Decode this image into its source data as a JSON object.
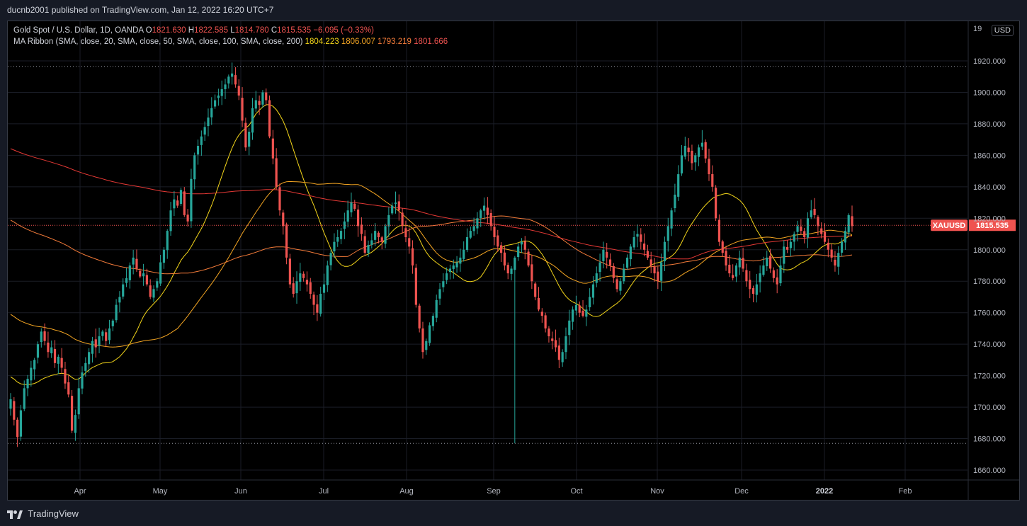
{
  "header": {
    "published_text": "ducnb2001 published on TradingView.com, Jan 12, 2022 16:20 UTC+7"
  },
  "legend": {
    "symbol_title": "Gold Spot / U.S. Dollar, 1D, OANDA",
    "o_label": "O",
    "o_value": "1821.630",
    "h_label": "H",
    "h_value": "1822.585",
    "l_label": "L",
    "l_value": "1814.780",
    "c_label": "C",
    "c_value": "1815.535",
    "change": "−6.095 (−0.33%)",
    "ma_title": "MA Ribbon (SMA, close, 20, SMA, close, 50, SMA, close, 100, SMA, close, 200)",
    "ma_values": [
      "1804.223",
      "1806.007",
      "1793.219",
      "1801.666"
    ]
  },
  "currency_badge": "USD",
  "price_tag": {
    "symbol": "XAUUSD",
    "value": "1815.535"
  },
  "footer": {
    "brand": "TradingView"
  },
  "colors": {
    "up": "#26a69a",
    "down": "#ef5350",
    "ma20": "#f5d71a",
    "ma50": "#f5a623",
    "ma100": "#f57c3a",
    "ma200": "#e53935",
    "background": "#000000",
    "grid": "#1a1d26"
  },
  "chart_data": {
    "type": "candlestick",
    "title": "Gold Spot / U.S. Dollar, 1D, OANDA",
    "ylim": [
      1650,
      1950
    ],
    "y_ticks": [
      "1660.000",
      "1680.000",
      "1700.000",
      "1720.000",
      "1740.000",
      "1760.000",
      "1780.000",
      "1800.000",
      "1820.000",
      "1840.000",
      "1860.000",
      "1880.000",
      "1900.000",
      "1920.000"
    ],
    "y_top_partial": "19",
    "x_ticks": [
      "Apr",
      "May",
      "Jun",
      "Jul",
      "Aug",
      "Sep",
      "Oct",
      "Nov",
      "Dec",
      "2022",
      "Feb"
    ],
    "current_price": 1815.535,
    "dotted_levels": [
      1916.5,
      1677.0
    ],
    "close_series_approx": [
      1705,
      1692,
      1681,
      1698,
      1712,
      1718,
      1725,
      1730,
      1740,
      1748,
      1742,
      1735,
      1738,
      1728,
      1732,
      1725,
      1715,
      1708,
      1685,
      1695,
      1712,
      1722,
      1728,
      1735,
      1742,
      1738,
      1745,
      1748,
      1742,
      1750,
      1755,
      1765,
      1770,
      1778,
      1782,
      1790,
      1795,
      1788,
      1783,
      1785,
      1778,
      1770,
      1775,
      1780,
      1792,
      1800,
      1812,
      1825,
      1832,
      1828,
      1838,
      1822,
      1818,
      1845,
      1860,
      1866,
      1872,
      1878,
      1884,
      1890,
      1895,
      1898,
      1902,
      1905,
      1910,
      1912,
      1905,
      1898,
      1882,
      1865,
      1875,
      1890,
      1895,
      1892,
      1900,
      1895,
      1872,
      1858,
      1840,
      1825,
      1815,
      1795,
      1778,
      1772,
      1780,
      1785,
      1782,
      1778,
      1772,
      1765,
      1760,
      1772,
      1778,
      1790,
      1798,
      1805,
      1808,
      1812,
      1818,
      1825,
      1830,
      1826,
      1815,
      1810,
      1798,
      1803,
      1806,
      1812,
      1808,
      1805,
      1815,
      1822,
      1828,
      1830,
      1825,
      1815,
      1808,
      1802,
      1790,
      1765,
      1750,
      1735,
      1742,
      1752,
      1758,
      1768,
      1775,
      1780,
      1785,
      1788,
      1790,
      1792,
      1795,
      1800,
      1808,
      1812,
      1815,
      1820,
      1825,
      1828,
      1822,
      1815,
      1808,
      1802,
      1798,
      1790,
      1785,
      1788,
      1795,
      1802,
      1805,
      1800,
      1790,
      1780,
      1770,
      1762,
      1758,
      1750,
      1745,
      1742,
      1738,
      1730,
      1735,
      1745,
      1755,
      1762,
      1765,
      1760,
      1758,
      1762,
      1770,
      1778,
      1785,
      1792,
      1800,
      1795,
      1790,
      1782,
      1775,
      1780,
      1788,
      1795,
      1802,
      1808,
      1810,
      1805,
      1800,
      1795,
      1790,
      1785,
      1780,
      1792,
      1805,
      1815,
      1825,
      1835,
      1848,
      1860,
      1866,
      1862,
      1855,
      1860,
      1865,
      1868,
      1858,
      1848,
      1840,
      1820,
      1805,
      1798,
      1790,
      1785,
      1782,
      1790,
      1795,
      1788,
      1780,
      1775,
      1772,
      1778,
      1785,
      1790,
      1795,
      1788,
      1782,
      1778,
      1790,
      1802,
      1800,
      1805,
      1810,
      1815,
      1812,
      1808,
      1820,
      1825,
      1822,
      1815,
      1810,
      1805,
      1800,
      1795,
      1790,
      1798,
      1805,
      1812,
      1822,
      1815
    ]
  }
}
